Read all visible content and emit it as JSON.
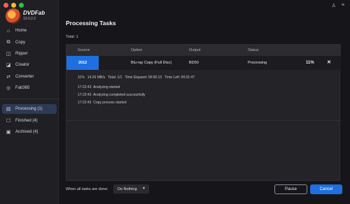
{
  "window": {
    "traffic_colors": [
      "#ff5f57",
      "#febc2e",
      "#28c840"
    ]
  },
  "app": {
    "brand": "DVDFab",
    "version": "13.0.2.2",
    "brand_color": "#1f6fe0"
  },
  "sidebar": {
    "items": [
      {
        "label": "Home",
        "icon": "home-icon"
      },
      {
        "label": "Copy",
        "icon": "copy-icon"
      },
      {
        "label": "Ripper",
        "icon": "ripper-icon"
      },
      {
        "label": "Creator",
        "icon": "creator-icon"
      },
      {
        "label": "Converter",
        "icon": "converter-icon"
      },
      {
        "label": "Fab365",
        "icon": "fab365-icon"
      }
    ],
    "queue": [
      {
        "label": "Processing (1)",
        "icon": "processing-icon",
        "active": true
      },
      {
        "label": "Finished (4)",
        "icon": "finished-icon"
      },
      {
        "label": "Archived (4)",
        "icon": "archived-icon"
      }
    ]
  },
  "main": {
    "title": "Processing Tasks",
    "total": "Total: 1",
    "columns": [
      "Source",
      "Option",
      "Output",
      "Status"
    ],
    "task": {
      "source": "2012",
      "option": "Blu-ray Copy (Full Disc)",
      "output": "BD50",
      "status": "Processing",
      "progress": "11%"
    },
    "info_line": "11%   14.26 MB/s   Total: 1/1   Time Elapsed: 00:00:13   Time Left: 00:01:47",
    "log": [
      "17:22:43  Analyzing started",
      "17:22:43  Analyzing completed successfully",
      "17:22:43  Copy process started"
    ]
  },
  "footer": {
    "when_done_label": "When all tasks are done:",
    "when_done_value": "Do Nothing",
    "pause_label": "Pause",
    "cancel_label": "Cancel"
  }
}
